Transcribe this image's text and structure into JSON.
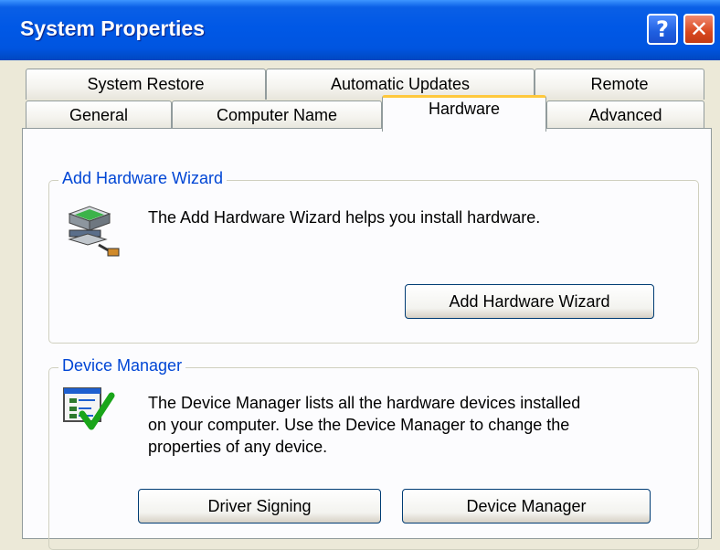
{
  "window": {
    "title": "System Properties",
    "help_label": "?",
    "close_label": "✕"
  },
  "tabs": {
    "row1": [
      "System Restore",
      "Automatic Updates",
      "Remote"
    ],
    "row2": [
      "General",
      "Computer Name",
      "Hardware",
      "Advanced"
    ],
    "active": "Hardware"
  },
  "add_hardware": {
    "group_label": "Add Hardware Wizard",
    "description": "The Add Hardware Wizard helps you install hardware.",
    "button_label": "Add Hardware Wizard",
    "icon": "hardware-wizard-icon"
  },
  "device_manager": {
    "group_label": "Device Manager",
    "description_lines": [
      "The Device Manager lists all the hardware devices installed",
      "on your computer. Use the Device Manager to change the",
      "properties of any device."
    ],
    "driver_signing_label": "Driver Signing",
    "button_label": "Device Manager",
    "icon": "device-manager-icon"
  },
  "colors": {
    "titlebar": "#0058e6",
    "group_label": "#0046d5",
    "active_tab_accent": "#ffc83c",
    "close_button": "#d8481f"
  }
}
